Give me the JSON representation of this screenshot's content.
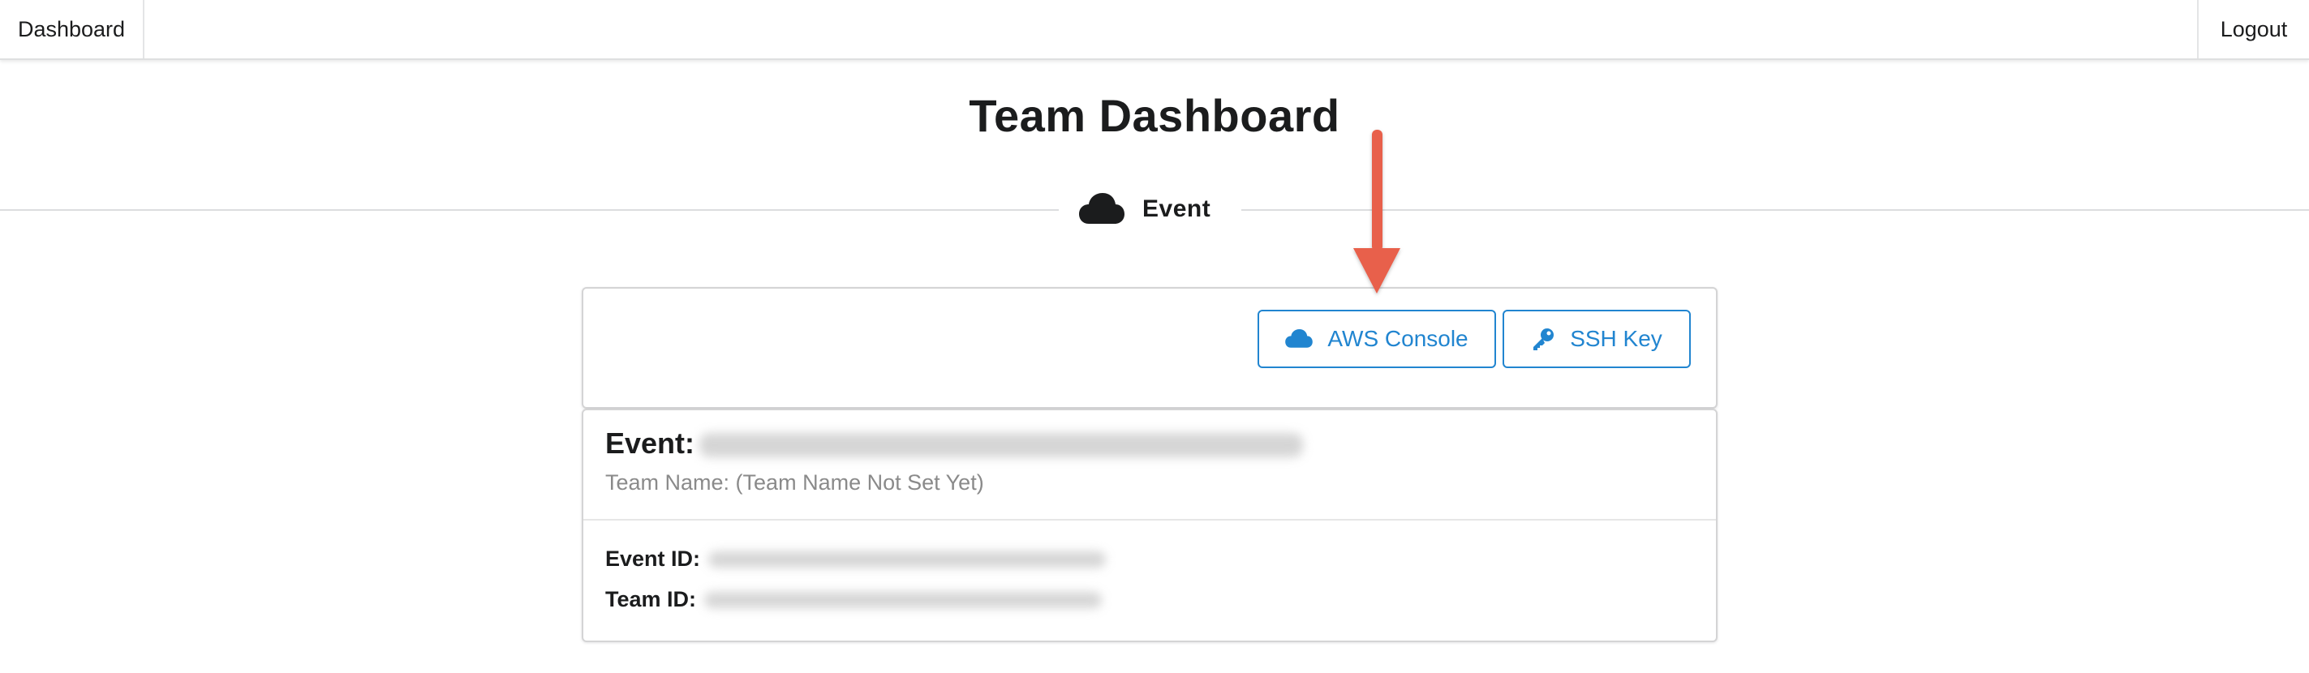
{
  "nav": {
    "dashboard_label": "Dashboard",
    "logout_label": "Logout"
  },
  "header": {
    "title": "Team Dashboard"
  },
  "section": {
    "label": "Event",
    "icon": "cloud-icon"
  },
  "toolbar": {
    "aws_console_label": "AWS Console",
    "aws_console_icon": "cloud-icon",
    "ssh_key_label": "SSH Key",
    "ssh_key_icon": "key-icon",
    "accent_color": "#2185d0"
  },
  "event": {
    "title_prefix": "Event:",
    "team_name_text": "Team Name: (Team Name Not Set Yet)",
    "event_id_label": "Event ID:",
    "team_id_label": "Team ID:"
  },
  "annotation": {
    "arrow_color": "#e8604c"
  }
}
